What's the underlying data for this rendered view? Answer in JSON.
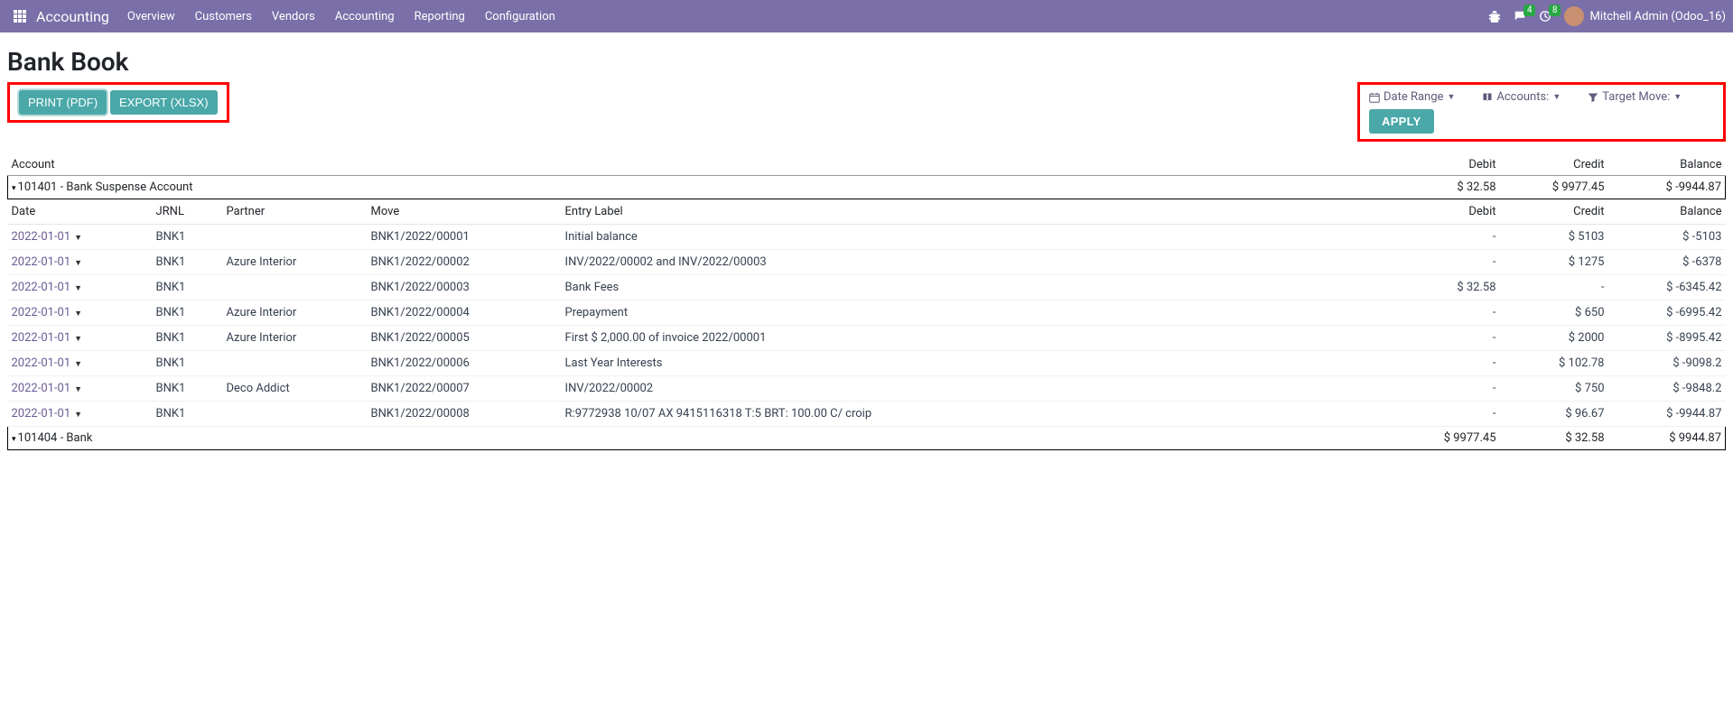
{
  "nav": {
    "brand": "Accounting",
    "items": [
      "Overview",
      "Customers",
      "Vendors",
      "Accounting",
      "Reporting",
      "Configuration"
    ],
    "msg_badge": "4",
    "act_badge": "8",
    "user": "Mitchell Admin (Odoo_16)"
  },
  "page": {
    "title": "Bank Book",
    "print_pdf": "PRINT (PDF)",
    "export_xlsx": "EXPORT (XLSX)",
    "apply": "APPLY"
  },
  "filters": {
    "date_range": "Date Range",
    "accounts": "Accounts:",
    "target_move": "Target Move:"
  },
  "summary_head": {
    "account": "Account",
    "debit": "Debit",
    "credit": "Credit",
    "balance": "Balance"
  },
  "detail_head": {
    "date": "Date",
    "jrnl": "JRNL",
    "partner": "Partner",
    "move": "Move",
    "entry_label": "Entry Label",
    "debit": "Debit",
    "credit": "Credit",
    "balance": "Balance"
  },
  "accounts": [
    {
      "name": "101401 - Bank Suspense Account",
      "debit": "$ 32.58",
      "credit": "$ 9977.45",
      "balance": "$ -9944.87",
      "rows": [
        {
          "date": "2022-01-01",
          "jrnl": "BNK1",
          "partner": "",
          "move": "BNK1/2022/00001",
          "label": "Initial balance",
          "debit": "-",
          "credit": "$ 5103",
          "balance": "$ -5103"
        },
        {
          "date": "2022-01-01",
          "jrnl": "BNK1",
          "partner": "Azure Interior",
          "move": "BNK1/2022/00002",
          "label": "INV/2022/00002 and INV/2022/00003",
          "debit": "-",
          "credit": "$ 1275",
          "balance": "$ -6378"
        },
        {
          "date": "2022-01-01",
          "jrnl": "BNK1",
          "partner": "",
          "move": "BNK1/2022/00003",
          "label": "Bank Fees",
          "debit": "$ 32.58",
          "credit": "-",
          "balance": "$ -6345.42"
        },
        {
          "date": "2022-01-01",
          "jrnl": "BNK1",
          "partner": "Azure Interior",
          "move": "BNK1/2022/00004",
          "label": "Prepayment",
          "debit": "-",
          "credit": "$ 650",
          "balance": "$ -6995.42"
        },
        {
          "date": "2022-01-01",
          "jrnl": "BNK1",
          "partner": "Azure Interior",
          "move": "BNK1/2022/00005",
          "label": "First $ 2,000.00 of invoice 2022/00001",
          "debit": "-",
          "credit": "$ 2000",
          "balance": "$ -8995.42"
        },
        {
          "date": "2022-01-01",
          "jrnl": "BNK1",
          "partner": "",
          "move": "BNK1/2022/00006",
          "label": "Last Year Interests",
          "debit": "-",
          "credit": "$ 102.78",
          "balance": "$ -9098.2"
        },
        {
          "date": "2022-01-01",
          "jrnl": "BNK1",
          "partner": "Deco Addict",
          "move": "BNK1/2022/00007",
          "label": "INV/2022/00002",
          "debit": "-",
          "credit": "$ 750",
          "balance": "$ -9848.2"
        },
        {
          "date": "2022-01-01",
          "jrnl": "BNK1",
          "partner": "",
          "move": "BNK1/2022/00008",
          "label": "R:9772938 10/07 AX 9415116318 T:5 BRT: 100.00 C/ croip",
          "debit": "-",
          "credit": "$ 96.67",
          "balance": "$ -9944.87"
        }
      ]
    },
    {
      "name": "101404 - Bank",
      "debit": "$ 9977.45",
      "credit": "$ 32.58",
      "balance": "$ 9944.87",
      "rows": []
    }
  ]
}
